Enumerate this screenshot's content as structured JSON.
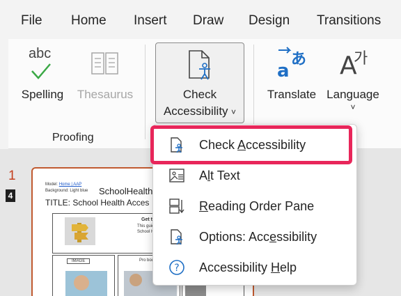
{
  "menubar": {
    "tabs": [
      "File",
      "Home",
      "Insert",
      "Draw",
      "Design",
      "Transitions"
    ]
  },
  "ribbon": {
    "spelling": {
      "icon_text": "abc",
      "label": "Spelling",
      "icon": "spelling-checkmark-icon"
    },
    "thesaurus": {
      "label": "Thesaurus",
      "icon": "book-icon"
    },
    "proofing_group_label": "Proofing",
    "check_accessibility": {
      "line1": "Check",
      "line2": "Accessibility",
      "chevron": "˅",
      "icon": "accessibility-document-icon"
    },
    "translate": {
      "label": "Translate",
      "icon": "translate-icon"
    },
    "language": {
      "label": "Language",
      "chevron": "˅",
      "icon": "language-icon",
      "glyph_a": "A",
      "glyph_ga": "가"
    }
  },
  "slide_panel": {
    "slide_number": "1",
    "badge": "4",
    "thumb": {
      "model_line": "Model:",
      "model_links": "Home | AAP",
      "background_line": "Background: Light blue",
      "header_title": "SchoolHealth.",
      "title_line": "TITLE: School Health Acces",
      "center_heading": "Get the Sch",
      "center_sub1": "This guide helps fam",
      "center_sub2": "School Health Reso",
      "panel_label_left": "IMAGE",
      "panel_label_right": "Pro body th"
    }
  },
  "dropdown": {
    "items": [
      {
        "pre": "Check ",
        "accel": "A",
        "post": "ccessibility",
        "icon": "accessibility-check-icon"
      },
      {
        "pre": "A",
        "accel": "l",
        "post": "t Text",
        "icon": "alt-text-icon"
      },
      {
        "pre": "",
        "accel": "R",
        "post": "eading Order Pane",
        "icon": "reading-order-icon"
      },
      {
        "pre": "Options: Acc",
        "accel": "e",
        "post": "ssibility",
        "icon": "accessibility-options-icon"
      },
      {
        "pre": "Accessibility ",
        "accel": "H",
        "post": "elp",
        "icon": "help-circle-icon"
      }
    ]
  },
  "colors": {
    "highlight": "#e8265a",
    "accent_blue": "#1f6fc5",
    "spelling_check": "#3aa845"
  }
}
